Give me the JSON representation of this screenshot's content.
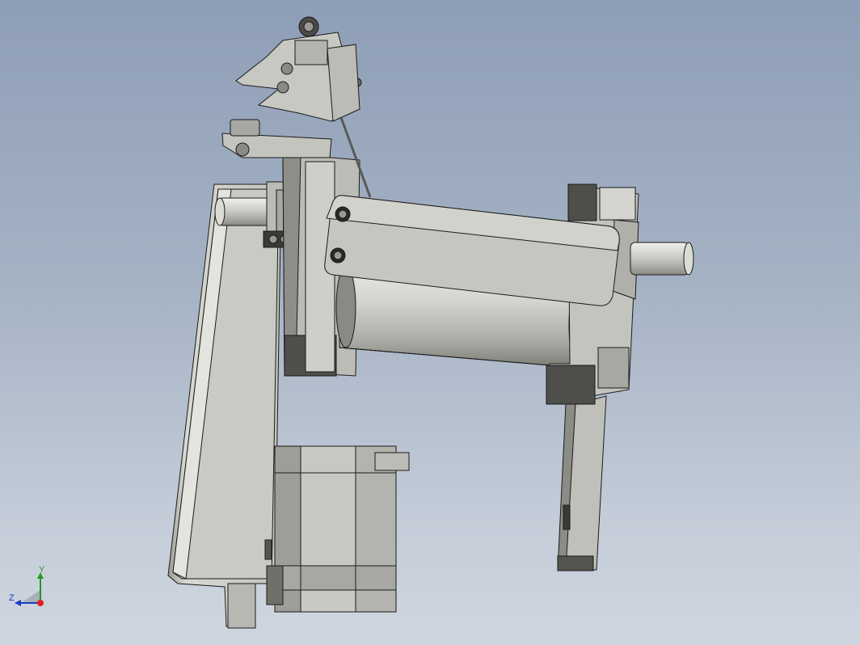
{
  "window": {
    "background_top": "#8e9eb6",
    "background_bottom": "#cfd6df"
  },
  "model": {
    "shade_light": "#e6e6e2",
    "shade_mid": "#c2c2bc",
    "shade_dark": "#8a8a84",
    "shade_darkest": "#4a4a46",
    "edge": "#1a1a1a"
  },
  "triad": {
    "y_label": "Y",
    "z_label": "Z",
    "y_color": "#1f9a1f",
    "z_color": "#1a3fbf",
    "origin_color": "#e02020"
  }
}
